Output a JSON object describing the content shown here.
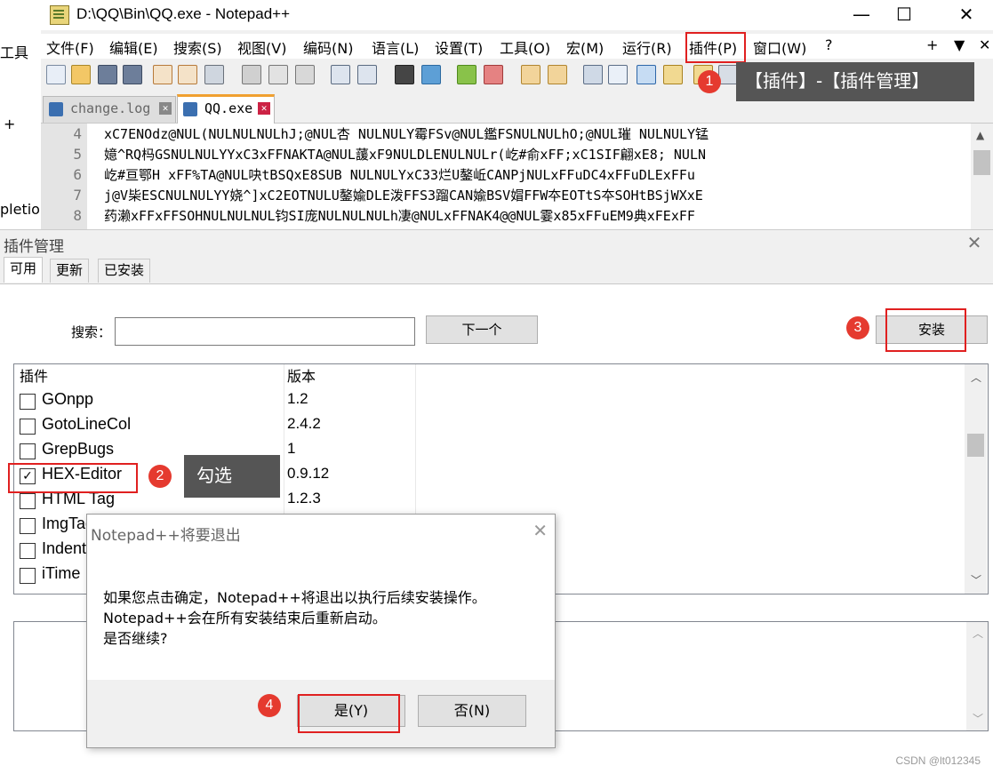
{
  "left_strip": {
    "line1": "工具",
    "line2": "+",
    "line3": "pletio"
  },
  "window": {
    "title": "D:\\QQ\\Bin\\QQ.exe - Notepad++",
    "minimize": "—",
    "maximize": "☐",
    "close": "✕"
  },
  "menu": {
    "items": [
      "文件(F)",
      "编辑(E)",
      "搜索(S)",
      "视图(V)",
      "编码(N)",
      "语言(L)",
      "设置(T)",
      "工具(O)",
      "宏(M)",
      "运行(R)",
      "插件(P)",
      "窗口(W)",
      "?"
    ],
    "right": [
      "+",
      "▼",
      "✕"
    ]
  },
  "tabs": [
    {
      "label": "change.log",
      "active": false
    },
    {
      "label": "QQ.exe",
      "active": true
    }
  ],
  "editor": {
    "line_numbers": [
      "4",
      "5",
      "6",
      "7",
      "8"
    ],
    "lines": [
      "xC7ENOdz@NUL(NULNULNULhJ;@NUL杏 NULNULY霉FSv@NUL鑑FSNULNULhO;@NUL璀 NULNULY锰",
      "嬑^RQ杩GSNULNULYYxC3xFFNAKTA@NUL蘐xF9NULDLENULNULr(屹#俞xFF;xC1SIF翩xE8; NULN",
      "屹#亘鄂H  xFF%TA@NUL吷tBSQxE8SUB NULNULYxC33烂U鏊岴CANPjNULxFFuDC4xFFuDLExFFu",
      "j@V枈ESCNULNULYY娆^]xC2EOTNULU鏊婾DLE泼FFS3蹓CAN婾BSV媢FFW夲EOTtS夲SOHtBSjWXxE",
      "药濑xFFxFFSOHNULNULNUL钧SI庞NULNULNULh凄@NULxFFNAK4@@NUL霎x85xFFuEM9典xFExFF"
    ]
  },
  "plugin_manager": {
    "title": "插件管理",
    "close": "✕",
    "tabs": [
      "可用",
      "更新",
      "已安装"
    ],
    "search_label": "搜索：",
    "search_value": "",
    "next_button": "下一个",
    "install_button": "安装",
    "columns": [
      "插件",
      "版本"
    ],
    "plugins": [
      {
        "name": "GOnpp",
        "version": "1.2",
        "checked": false
      },
      {
        "name": "GotoLineCol",
        "version": "2.4.2",
        "checked": false
      },
      {
        "name": "GrepBugs",
        "version": "1",
        "checked": false
      },
      {
        "name": "HEX-Editor",
        "version": "0.9.12",
        "checked": true
      },
      {
        "name": "HTML Tag",
        "version": "1.2.3",
        "checked": false
      },
      {
        "name": "ImgTag",
        "version": "",
        "checked": false
      },
      {
        "name": "Indent",
        "version": "",
        "checked": false
      },
      {
        "name": "iTime",
        "version": "",
        "checked": false
      }
    ]
  },
  "confirm_dialog": {
    "title": "Notepad++将要退出",
    "close": "✕",
    "lines": [
      "如果您点击确定，Notepad++将退出以执行后续安装操作。",
      "Notepad++会在所有安装结束后重新启动。",
      "是否继续?"
    ],
    "yes_button": "是(Y)",
    "no_button": "否(N)"
  },
  "annotations": {
    "badges": [
      "1",
      "2",
      "3",
      "4"
    ],
    "callout_menu": "【插件】-【插件管理】",
    "callout_check": "勾选",
    "accent_color": "#e02020"
  },
  "watermark": "CSDN @lt012345"
}
